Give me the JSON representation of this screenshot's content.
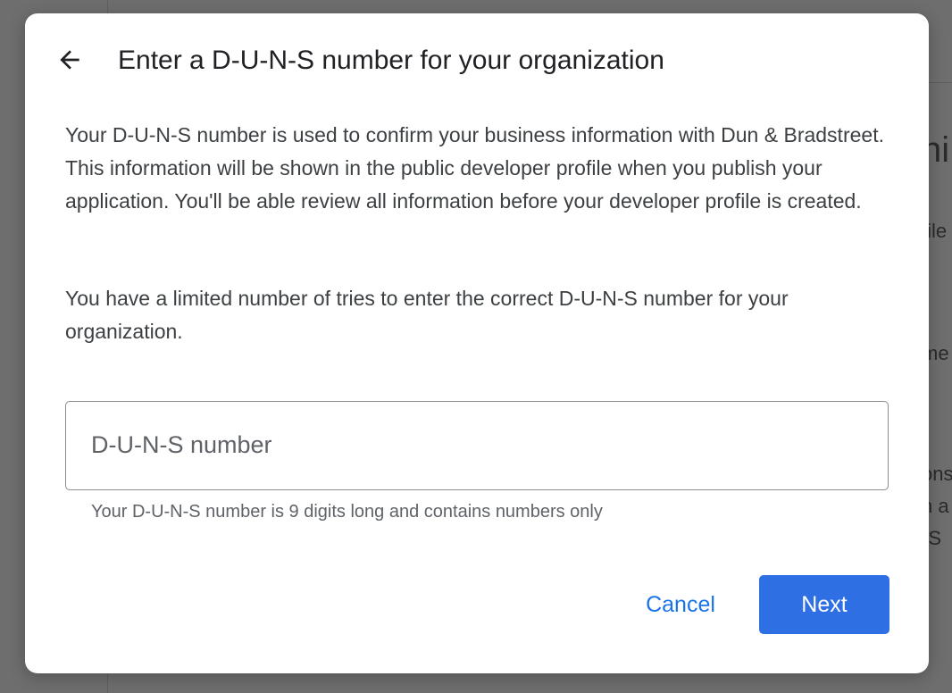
{
  "background": {
    "fragments": [
      "ni",
      "file",
      "me",
      "ons",
      "n a",
      "-S"
    ]
  },
  "dialog": {
    "title": "Enter a D-U-N-S number for your organization",
    "back_icon": "arrow-left-icon",
    "paragraph_1": "Your D-U-N-S number is used to confirm your business information with Dun & Bradstreet. This information will be shown in the public developer profile when you publish your application. You'll be able review all information before your developer profile is created.",
    "paragraph_2": "You have a limited number of tries to enter the correct D-U-N-S number for your organization.",
    "input": {
      "value": "",
      "placeholder": "D-U-N-S number"
    },
    "helper_text": "Your D-U-N-S number is 9 digits long and contains numbers only",
    "cancel_label": "Cancel",
    "next_label": "Next"
  },
  "colors": {
    "accent": "#1a73e8",
    "primary_button": "#2f6fe4",
    "overlay": "#6e6e6e"
  }
}
